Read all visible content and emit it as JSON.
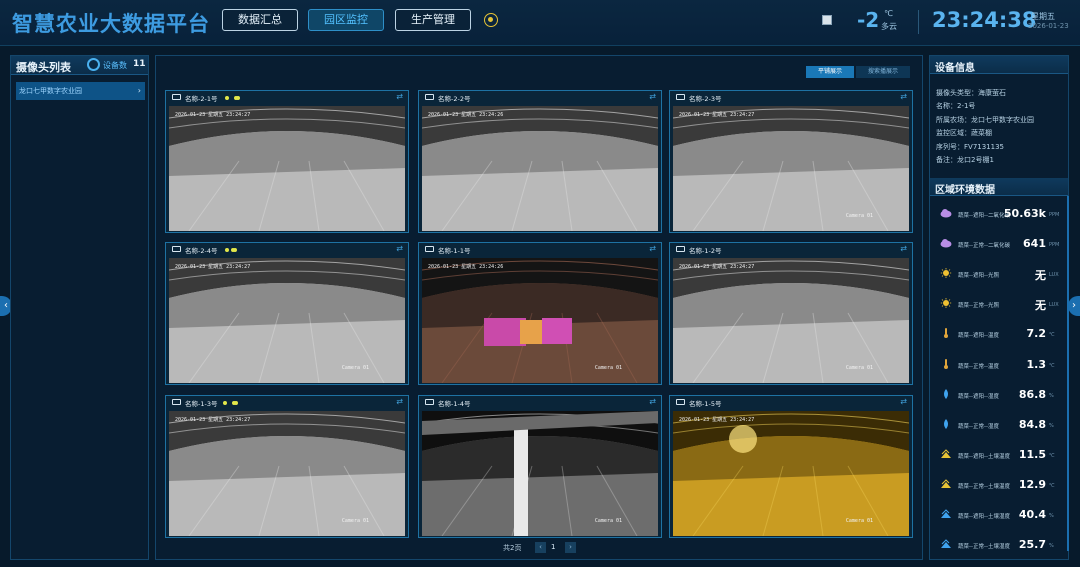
{
  "header": {
    "title": "智慧农业大数据平台",
    "nav": [
      {
        "label": "数据汇总",
        "active": false
      },
      {
        "label": "园区监控",
        "active": true
      },
      {
        "label": "生产管理",
        "active": false
      }
    ],
    "weather": {
      "temperature": "-2",
      "unit": "℃",
      "description": "多云",
      "icon": "weather-image-icon"
    },
    "time": "23:24:38",
    "weekday": "星期五",
    "date": "2026-01-23"
  },
  "left_panel": {
    "title": "摄像头列表",
    "device_count_label": "设备数",
    "device_count": "11",
    "group": {
      "label": "龙口七甲数字农业园",
      "chevron": "›"
    }
  },
  "center": {
    "view_modes": [
      "平铺展示",
      "搜索播展示"
    ],
    "cameras": [
      {
        "name": "名称-2-1号",
        "timestamp": "2026-01-23 星期五 23:24:27",
        "label": "",
        "tone": "gray"
      },
      {
        "name": "名称-2-2号",
        "timestamp": "2026-01-23 星期五 23:24:26",
        "label": "",
        "tone": "gray"
      },
      {
        "name": "名称-2-3号",
        "timestamp": "2026-01-23 星期五 23:24:27",
        "label": "Camera 01",
        "tone": "gray"
      },
      {
        "name": "名称-2-4号",
        "timestamp": "2026-01-23 星期五 23:24:27",
        "label": "Camera 01",
        "tone": "gray"
      },
      {
        "name": "名称-1-1号",
        "timestamp": "2026-01-23 星期五 23:24:26",
        "label": "Camera 01",
        "tone": "warm"
      },
      {
        "name": "名称-1-2号",
        "timestamp": "2026-01-23 星期五 23:24:27",
        "label": "Camera 01",
        "tone": "gray"
      },
      {
        "name": "名称-1-3号",
        "timestamp": "2026-01-23 星期五 23:24:27",
        "label": "Camera 01",
        "tone": "gray"
      },
      {
        "name": "名称-1-4号",
        "timestamp": "",
        "label": "Camera 01",
        "tone": "dark"
      },
      {
        "name": "名称-1-5号",
        "timestamp": "2026-01-23 星期五 23:24:27",
        "label": "Camera 01",
        "tone": "yellow"
      }
    ],
    "pager": {
      "total_label": "共2页",
      "prev": "‹",
      "page": "1",
      "next": "›"
    }
  },
  "right_panel": {
    "device_info_title": "设备信息",
    "device_info": [
      "摄像头类型：海康萤石",
      "名称：2-1号",
      "所属农场：龙口七甲数字农业园",
      "监控区域：蔬菜棚",
      "序列号：FV7131135",
      "备注：龙口2号棚1"
    ],
    "env_title": "区域环境数据",
    "env_data": [
      {
        "label": "蔬菜--遮阳--二氧化碳",
        "value": "50.63k",
        "unit": "PPM",
        "icon": "co2-cloud-icon"
      },
      {
        "label": "蔬菜--正常--二氧化碳",
        "value": "641",
        "unit": "PPM",
        "icon": "co2-cloud-icon"
      },
      {
        "label": "蔬菜--遮阳--光照",
        "value": "无",
        "unit": "LUX",
        "icon": "sun-icon"
      },
      {
        "label": "蔬菜--正常--光照",
        "value": "无",
        "unit": "LUX",
        "icon": "sun-icon"
      },
      {
        "label": "蔬菜--遮阳--温度",
        "value": "7.2",
        "unit": "℃",
        "icon": "thermometer-icon"
      },
      {
        "label": "蔬菜--正常--温度",
        "value": "1.3",
        "unit": "℃",
        "icon": "thermometer-icon"
      },
      {
        "label": "蔬菜--遮阳--湿度",
        "value": "86.8",
        "unit": "%",
        "icon": "water-drop-icon"
      },
      {
        "label": "蔬菜--正常--湿度",
        "value": "84.8",
        "unit": "%",
        "icon": "water-drop-icon"
      },
      {
        "label": "蔬菜--遮阳--土壤温度",
        "value": "11.5",
        "unit": "℃",
        "icon": "soil-temperature-icon"
      },
      {
        "label": "蔬菜--正常--土壤温度",
        "value": "12.9",
        "unit": "℃",
        "icon": "soil-temperature-icon"
      },
      {
        "label": "蔬菜--遮阳--土壤湿度",
        "value": "40.4",
        "unit": "%",
        "icon": "soil-moisture-icon"
      },
      {
        "label": "蔬菜--正常--土壤湿度",
        "value": "25.7",
        "unit": "%",
        "icon": "soil-moisture-icon"
      }
    ]
  },
  "side_arrows": {
    "left": "‹",
    "right": "›"
  },
  "colors": {
    "accent": "#3d9be0",
    "active_nav": "#53c1ff",
    "status_dot": "#e2e64a",
    "panel_border": "#14466b"
  }
}
